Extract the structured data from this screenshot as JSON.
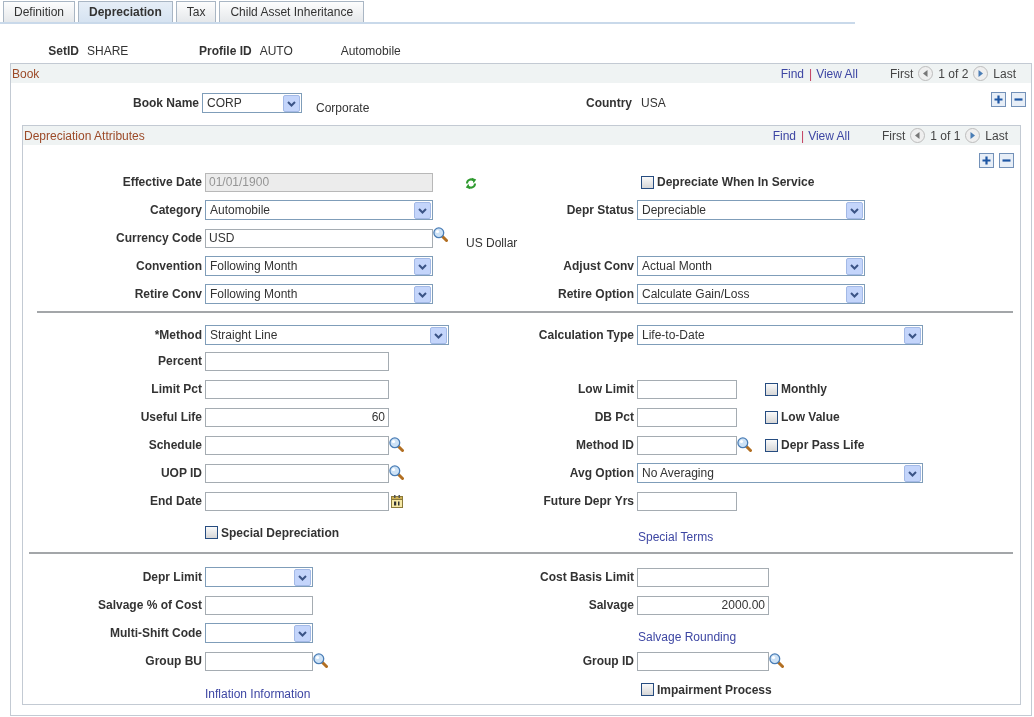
{
  "tabs": [
    {
      "label": "Definition",
      "selected": false
    },
    {
      "label": "Depreciation",
      "selected": true
    },
    {
      "label": "Tax",
      "selected": false
    },
    {
      "label": "Child Asset Inheritance",
      "selected": false
    }
  ],
  "keys": [
    {
      "label": "SetID",
      "value": "SHARE"
    },
    {
      "label": "Profile ID",
      "value": "AUTO",
      "description": "Automobile"
    }
  ],
  "book": {
    "title": "Book",
    "nav": {
      "find": "Find",
      "separator": "|",
      "view_all": "View All",
      "first": "First",
      "position": "1 of 2",
      "last": "Last"
    },
    "rows": [
      {
        "left": {
          "kind": "select",
          "label": "Book Name",
          "value": "CORP",
          "description": "Corporate",
          "disabled": false
        },
        "right": {
          "kind": "text",
          "label": "Country",
          "value": "USA"
        }
      }
    ],
    "attributes": {
      "title": "Depreciation Attributes",
      "nav": {
        "find": "Find",
        "separator": "|",
        "view_all": "View All",
        "first": "First",
        "position": "1 of 1",
        "last": "Last"
      },
      "sections": [
        {
          "rows": [
            {
              "left": {
                "kind": "input",
                "label": "Effective Date",
                "value": "01/01/1900",
                "disabled": true,
                "refresh_button": true
              },
              "right": {
                "kind": "checkbox",
                "label": "Depreciate When In Service",
                "checked": false
              }
            },
            {
              "left": {
                "kind": "select",
                "label": "Category",
                "value": "Automobile",
                "disabled": false
              },
              "right": {
                "kind": "select",
                "label": "Depr Status",
                "value": "Depreciable",
                "disabled": false
              }
            },
            {
              "left": {
                "kind": "lookup",
                "label": "Currency Code",
                "value": "USD",
                "description": "US Dollar",
                "disabled": false
              }
            },
            {
              "left": {
                "kind": "select",
                "label": "Convention",
                "value": "Following Month",
                "disabled": false
              },
              "right": {
                "kind": "select",
                "label": "Adjust Conv",
                "value": "Actual Month",
                "disabled": false
              }
            },
            {
              "left": {
                "kind": "select",
                "label": "Retire Conv",
                "value": "Following Month",
                "disabled": false
              },
              "right": {
                "kind": "select",
                "label": "Retire Option",
                "value": "Calculate Gain/Loss",
                "disabled": false
              }
            }
          ]
        },
        {
          "rows": [
            {
              "left": {
                "kind": "select",
                "label": "*Method",
                "value": "Straight Line",
                "disabled": false
              },
              "right": {
                "kind": "select",
                "label": "Calculation Type",
                "value": "Life-to-Date",
                "disabled": false
              }
            },
            {
              "left": {
                "kind": "input",
                "label": "Percent",
                "disabled": false
              }
            },
            {
              "left": {
                "kind": "input",
                "label": "Limit Pct",
                "disabled": false
              },
              "right": {
                "kind": "input",
                "label": "Low Limit",
                "disabled": false
              },
              "flag": {
                "label": "Monthly",
                "checked": false
              }
            },
            {
              "left": {
                "kind": "number",
                "label": "Useful Life",
                "value": "60",
                "disabled": false
              },
              "right": {
                "kind": "input",
                "label": "DB Pct",
                "disabled": false
              },
              "flag": {
                "label": "Low Value",
                "checked": false
              }
            },
            {
              "left": {
                "kind": "lookup",
                "label": "Schedule",
                "disabled": false
              },
              "right": {
                "kind": "lookup",
                "label": "Method ID",
                "disabled": false
              },
              "flag": {
                "label": "Depr Pass Life",
                "checked": false
              }
            },
            {
              "left": {
                "kind": "lookup",
                "label": "UOP ID",
                "disabled": false
              },
              "right": {
                "kind": "select",
                "label": "Avg Option",
                "value": "No Averaging",
                "disabled": false
              }
            },
            {
              "left": {
                "kind": "date",
                "label": "End Date",
                "disabled": false
              },
              "right": {
                "kind": "input",
                "label": "Future Depr Yrs",
                "disabled": false
              }
            },
            {
              "left": {
                "kind": "checkbox",
                "label": "Special Depreciation",
                "checked": false
              },
              "right": {
                "kind": "link",
                "label": "Special Terms"
              }
            }
          ]
        },
        {
          "rows": [
            {
              "left": {
                "kind": "select",
                "label": "Depr Limit",
                "disabled": false
              },
              "right": {
                "kind": "input",
                "label": "Cost Basis Limit",
                "disabled": false
              }
            },
            {
              "left": {
                "kind": "input",
                "label": "Salvage % of Cost",
                "disabled": false
              },
              "right": {
                "kind": "number",
                "label": "Salvage",
                "value": "2000.00",
                "disabled": false
              }
            },
            {
              "left": {
                "kind": "select",
                "label": "Multi-Shift Code",
                "disabled": false
              },
              "right": {
                "kind": "link",
                "label": "Salvage Rounding"
              }
            },
            {
              "left": {
                "kind": "lookup",
                "label": "Group BU",
                "disabled": false
              },
              "right": {
                "kind": "lookup",
                "label": "Group ID",
                "disabled": false
              }
            },
            {
              "left": {
                "kind": "link",
                "label": "Inflation Information"
              },
              "right": {
                "kind": "checkbox",
                "label": "Impairment Process",
                "checked": false
              }
            }
          ]
        }
      ]
    }
  }
}
